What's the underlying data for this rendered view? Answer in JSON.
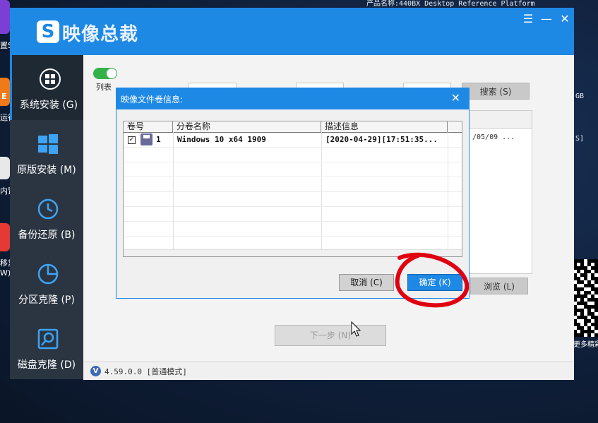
{
  "desktop": {
    "top_text": "产品名称:440BX Desktop Reference Platform",
    "left_labels": [
      "置S",
      "E",
      "运行",
      "内置",
      "移复",
      "W)"
    ],
    "right_labels": [
      "GB",
      "S]"
    ],
    "qr_caption": "更多精彩"
  },
  "app": {
    "logo_glyph": "S",
    "title": "映像总裁",
    "window_buttons": {
      "menu": "☰",
      "minimize": "—",
      "close": "✕"
    },
    "sidebar": [
      {
        "label": "系统安装 (G)",
        "icon": "windows-logo-circle-icon"
      },
      {
        "label": "原版安装 (M)",
        "icon": "windows-logo-icon"
      },
      {
        "label": "备份还原 (B)",
        "icon": "clock-restore-icon"
      },
      {
        "label": "分区克隆 (P)",
        "icon": "pie-chart-icon"
      },
      {
        "label": "磁盘克隆 (D)",
        "icon": "disk-search-icon"
      }
    ],
    "list_toggle_label": "列表",
    "search_button": "搜索 (S)",
    "browse_button": "浏览 (L)",
    "bg_cell_date": "/05/09 ...",
    "next_button": "下一步 (N)",
    "version_badge": "V",
    "version": "4.59.0.0 [普通模式]"
  },
  "dialog": {
    "title": "映像文件卷信息:",
    "close": "✕",
    "columns": [
      "卷号",
      "分卷名称",
      "描述信息"
    ],
    "rows": [
      {
        "checked": true,
        "check_glyph": "✓",
        "index": "1",
        "name": "Windows 10 x64 1909",
        "desc": "[2020-04-29][17:51:35..."
      }
    ],
    "cancel_button": "取消 (C)",
    "ok_button": "确定 (K)"
  },
  "colors": {
    "accent": "#1e88e5",
    "sidebar": "#2b3541",
    "toggle_on": "#33b24a",
    "annotation": "#e00010"
  }
}
